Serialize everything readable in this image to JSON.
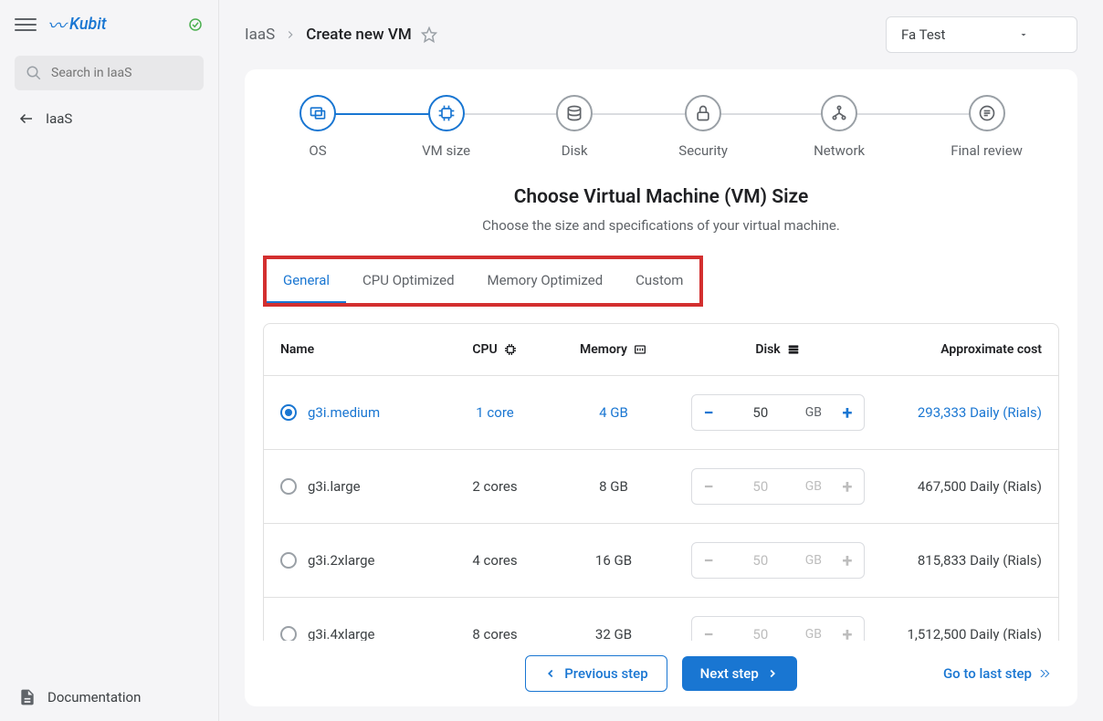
{
  "sidebar": {
    "logo": "Kubit",
    "search_placeholder": "Search in IaaS",
    "back_label": "IaaS",
    "doc_label": "Documentation"
  },
  "breadcrumb": {
    "root": "IaaS",
    "current": "Create new VM"
  },
  "project_select": "Fa Test",
  "stepper": {
    "steps": [
      "OS",
      "VM size",
      "Disk",
      "Security",
      "Network",
      "Final review"
    ]
  },
  "heading": {
    "title": "Choose Virtual Machine (VM) Size",
    "subtitle": "Choose the size and specifications of your virtual machine."
  },
  "tabs": [
    "General",
    "CPU Optimized",
    "Memory Optimized",
    "Custom"
  ],
  "table": {
    "headers": {
      "name": "Name",
      "cpu": "CPU",
      "memory": "Memory",
      "disk": "Disk",
      "cost": "Approximate cost"
    },
    "disk_unit": "GB",
    "rows": [
      {
        "name": "g3i.medium",
        "cpu": "1 core",
        "memory": "4 GB",
        "disk": "50",
        "cost": "293,333 Daily (Rials)",
        "selected": true
      },
      {
        "name": "g3i.large",
        "cpu": "2 cores",
        "memory": "8 GB",
        "disk": "50",
        "cost": "467,500 Daily (Rials)",
        "selected": false
      },
      {
        "name": "g3i.2xlarge",
        "cpu": "4 cores",
        "memory": "16 GB",
        "disk": "50",
        "cost": "815,833 Daily (Rials)",
        "selected": false
      },
      {
        "name": "g3i.4xlarge",
        "cpu": "8 cores",
        "memory": "32 GB",
        "disk": "50",
        "cost": "1,512,500 Daily (Rials)",
        "selected": false
      }
    ]
  },
  "footer": {
    "prev": "Previous step",
    "next": "Next step",
    "last": "Go to last step"
  }
}
